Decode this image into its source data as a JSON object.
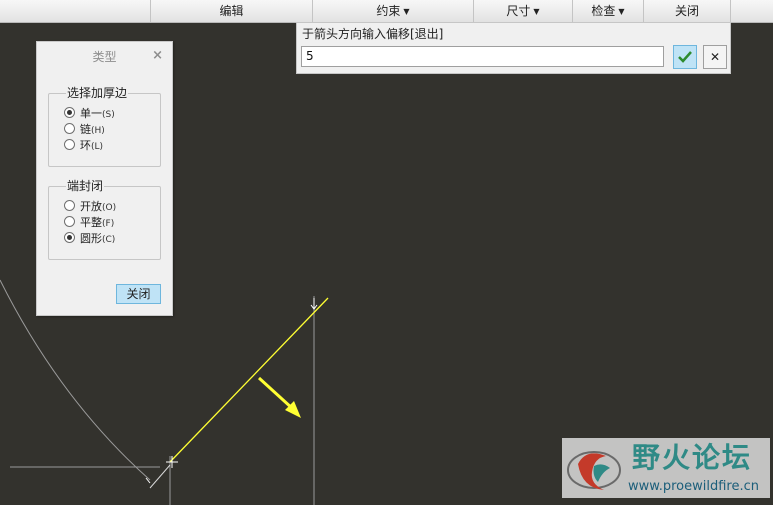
{
  "toolbar": {
    "edit": "编辑",
    "constrain": "约束",
    "dimension": "尺寸",
    "inspect": "检查",
    "close": "关闭"
  },
  "type_dialog": {
    "title": "类型",
    "thicken_group": {
      "title": "选择加厚边",
      "options": [
        {
          "label": "单一",
          "hotkey": "(S)",
          "selected": true
        },
        {
          "label": "链",
          "hotkey": "(H)",
          "selected": false
        },
        {
          "label": "环",
          "hotkey": "(L)",
          "selected": false
        }
      ]
    },
    "end_cap_group": {
      "title": "端封闭",
      "options": [
        {
          "label": "开放",
          "hotkey": "(O)",
          "selected": false
        },
        {
          "label": "平整",
          "hotkey": "(F)",
          "selected": false
        },
        {
          "label": "圆形",
          "hotkey": "(C)",
          "selected": true
        }
      ]
    },
    "close_button": "关闭"
  },
  "prompt": {
    "label": "于箭头方向输入偏移[退出]",
    "value": "5"
  },
  "watermark": {
    "title": "野火论坛",
    "url": "www.proewildfire.cn"
  },
  "colors": {
    "canvas": "#33322d",
    "sketch_line": "#ffff33",
    "arrow": "#ffff33",
    "accent_button": "#bfe3f6",
    "watermark_text": "#2f8a86"
  }
}
